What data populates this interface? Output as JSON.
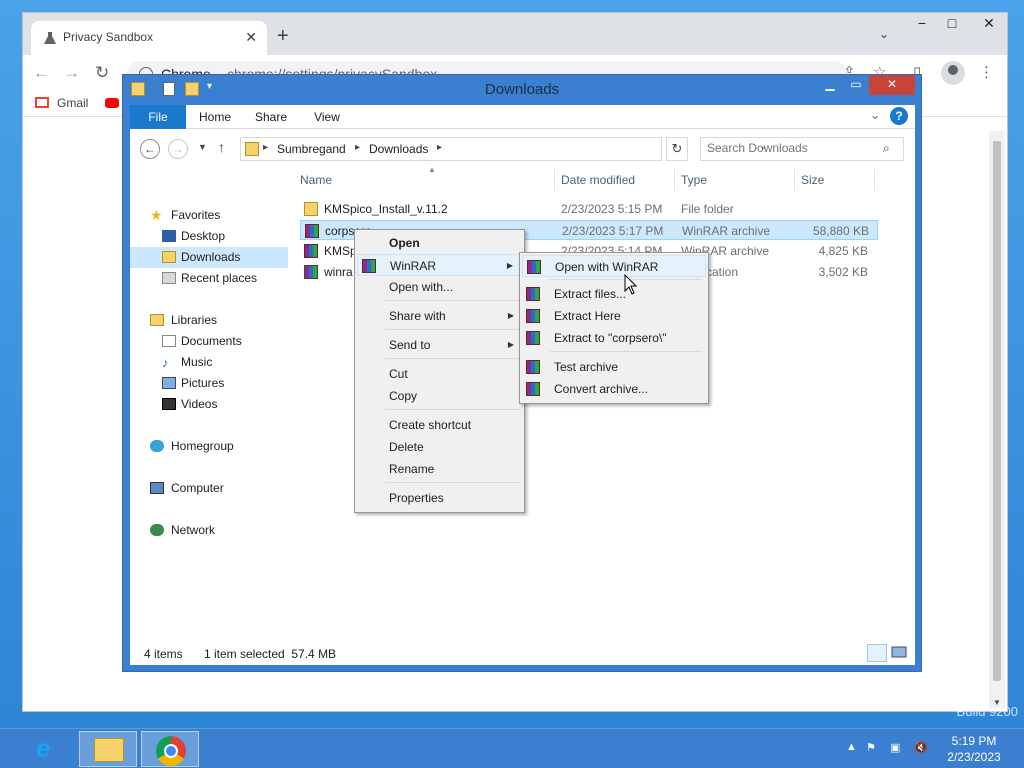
{
  "browser": {
    "tab_title": "Privacy Sandbox",
    "site_label": "Chrome",
    "url": "chrome://settings/privacySandbox",
    "bookmarks": [
      "Gmail"
    ]
  },
  "explorer": {
    "title": "Downloads",
    "ribbon_tabs": [
      "File",
      "Home",
      "Share",
      "View"
    ],
    "breadcrumb": [
      "Sumbregand",
      "Downloads"
    ],
    "search_placeholder": "Search Downloads",
    "nav": {
      "favorites": "Favorites",
      "desktop": "Desktop",
      "downloads": "Downloads",
      "recent": "Recent places",
      "libraries": "Libraries",
      "documents": "Documents",
      "music": "Music",
      "pictures": "Pictures",
      "videos": "Videos",
      "homegroup": "Homegroup",
      "computer": "Computer",
      "network": "Network"
    },
    "columns": [
      "Name",
      "Date modified",
      "Type",
      "Size"
    ],
    "files": [
      {
        "name": "KMSpico_Install_v.11.2",
        "date": "2/23/2023 5:15 PM",
        "type": "File folder",
        "size": "",
        "icon": "folder-icon"
      },
      {
        "name": "corpsero",
        "date": "2/23/2023 5:17 PM",
        "type": "WinRAR archive",
        "size": "58,880 KB",
        "icon": "winrar-archive-icon",
        "selected": true
      },
      {
        "name": "KMSp",
        "date": "2/23/2023 5:14 PM",
        "type": "WinRAR archive",
        "size": "4,825 KB",
        "icon": "winrar-archive-icon"
      },
      {
        "name": "winra",
        "date": "",
        "type": "plication",
        "size": "3,502 KB",
        "icon": "application-icon"
      }
    ],
    "status": {
      "items": "4 items",
      "selected": "1 item selected  57.4 MB"
    }
  },
  "context_menu": {
    "items": [
      "Open",
      "WinRAR",
      "Open with...",
      "Share with",
      "Send to",
      "Cut",
      "Copy",
      "Create shortcut",
      "Delete",
      "Rename",
      "Properties"
    ]
  },
  "winrar_submenu": {
    "items": [
      "Open with WinRAR",
      "Extract files...",
      "Extract Here",
      "Extract to \"corpsero\\\"",
      "Test archive",
      "Convert archive..."
    ]
  },
  "taskbar": {
    "time": "5:19 PM",
    "date": "2/23/2023"
  },
  "watermark": "Build 9200",
  "colors": {
    "explorer_frame": "#3a7fd0",
    "file_tab": "#1979ca",
    "selection": "#cce8ff",
    "close_button": "#c7443a"
  }
}
